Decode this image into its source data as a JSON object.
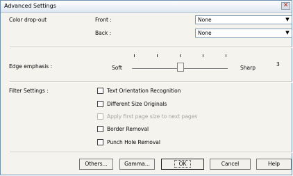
{
  "window": {
    "title": "Advanced Settings"
  },
  "color_dropout": {
    "label": "Color drop-out",
    "front_label": "Front :",
    "front_value": "None",
    "back_label": "Back :",
    "back_value": "None"
  },
  "edge": {
    "label": "Edge emphasis :",
    "soft": "Soft",
    "sharp": "Sharp",
    "value": "3"
  },
  "filter": {
    "label": "Filter Settings :",
    "items": [
      {
        "text": "Text Orientation Recognition",
        "checked": false,
        "enabled": true
      },
      {
        "text": "Different Size Originals",
        "checked": false,
        "enabled": true
      },
      {
        "text": "Apply first page size to next pages",
        "checked": false,
        "enabled": false
      },
      {
        "text": "Border Removal",
        "checked": false,
        "enabled": true
      },
      {
        "text": "Punch Hole Removal",
        "checked": false,
        "enabled": true
      }
    ]
  },
  "buttons": {
    "others": "Others...",
    "gamma": "Gamma...",
    "ok": "OK",
    "cancel": "Cancel",
    "help": "Help"
  }
}
